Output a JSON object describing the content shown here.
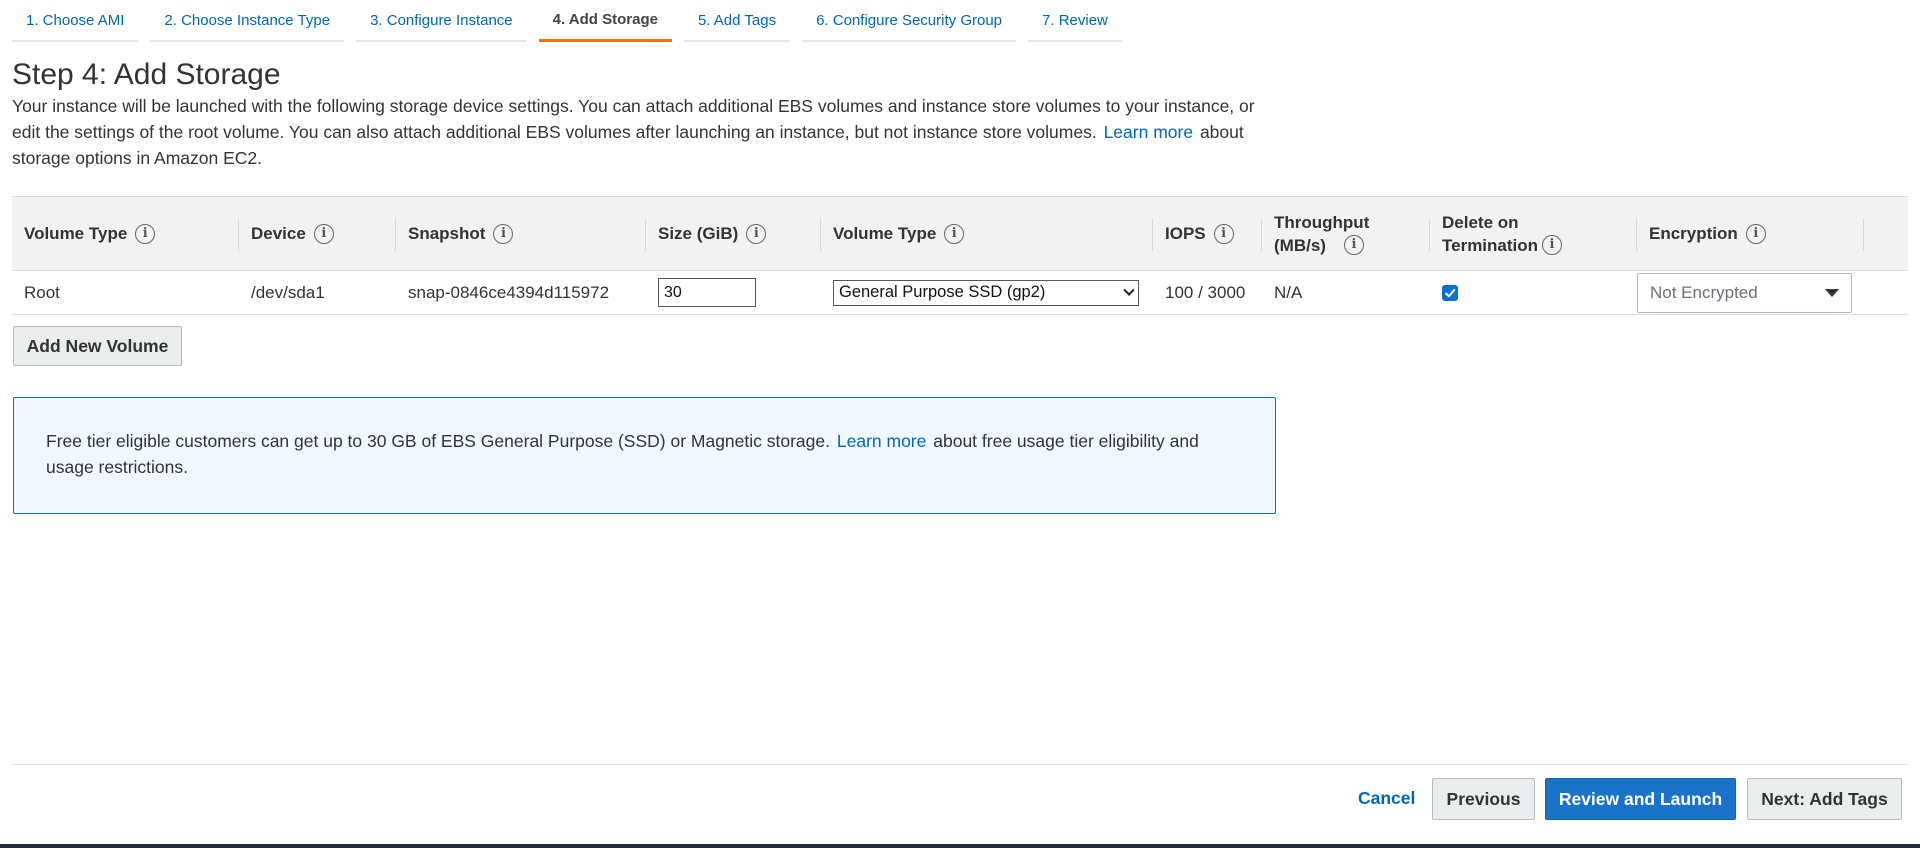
{
  "wizard": {
    "tabs": [
      {
        "label": "1. Choose AMI"
      },
      {
        "label": "2. Choose Instance Type"
      },
      {
        "label": "3. Configure Instance"
      },
      {
        "label": "4. Add Storage"
      },
      {
        "label": "5. Add Tags"
      },
      {
        "label": "6. Configure Security Group"
      },
      {
        "label": "7. Review"
      }
    ],
    "active_index": 3
  },
  "header": {
    "title": "Step 4: Add Storage",
    "intro_text": "Your instance will be launched with the following storage device settings. You can attach additional EBS volumes and instance store volumes to your instance, or edit the settings of the root volume. You can also attach additional EBS volumes after launching an instance, but not instance store volumes.",
    "learn_more": "Learn more",
    "intro_suffix": "about storage options in Amazon EC2."
  },
  "table": {
    "columns": {
      "volume_type": "Volume Type",
      "device": "Device",
      "snapshot": "Snapshot",
      "size": "Size (GiB)",
      "volume_type2": "Volume Type",
      "iops": "IOPS",
      "throughput": "Throughput (MB/s)",
      "delete_on_termination": "Delete on Termination",
      "encryption": "Encryption"
    },
    "rows": [
      {
        "volume_type": "Root",
        "device": "/dev/sda1",
        "snapshot": "snap-0846ce4394d115972",
        "size": "30",
        "ebs_type": "General Purpose SSD (gp2)",
        "iops": "100 / 3000",
        "throughput": "N/A",
        "delete_on_termination": true,
        "encryption": "Not Encrypted"
      }
    ]
  },
  "actions": {
    "add_volume": "Add New Volume",
    "cancel": "Cancel",
    "previous": "Previous",
    "review_launch": "Review and Launch",
    "next": "Next: Add Tags"
  },
  "info_box": {
    "text": "Free tier eligible customers can get up to 30 GB of EBS General Purpose (SSD) or Magnetic storage.",
    "learn_more": "Learn more",
    "suffix": "about free usage tier eligibility and usage restrictions."
  },
  "colors": {
    "link": "#0066b8",
    "active_tab": "#ec7211",
    "primary_button": "#1a73c8",
    "info_border": "#0a6fd1",
    "info_background": "#f0f7ff"
  }
}
